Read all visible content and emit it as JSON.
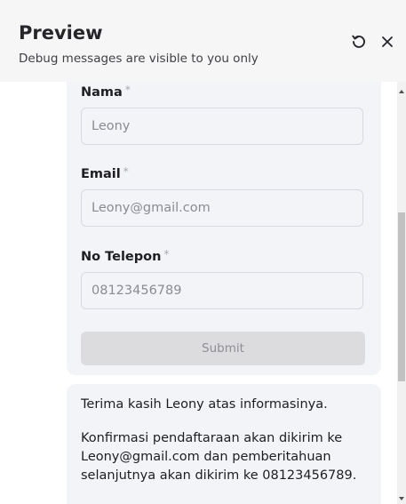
{
  "header": {
    "title": "Preview",
    "subtitle": "Debug messages are visible to you only",
    "icons": [
      "refresh-icon",
      "close-icon"
    ]
  },
  "form": {
    "fields": [
      {
        "label": "Nama",
        "required_mark": "*",
        "value": "Leony"
      },
      {
        "label": "Email",
        "required_mark": "*",
        "value": "Leony@gmail.com"
      },
      {
        "label": "No Telepon",
        "required_mark": "*",
        "value": "08123456789"
      }
    ],
    "submit_label": "Submit"
  },
  "message": {
    "line1": "Terima kasih Leony atas informasinya.",
    "line2": "Konfirmasi pendaftaraan akan dikirim ke Leony@gmail.com dan pemberitahuan selanjutnya akan dikirim ke 08123456789."
  },
  "colors": {
    "header_bg": "#f6f6f7",
    "card_bg": "#f3f4f8",
    "submit_bg": "#dcdcdf"
  }
}
